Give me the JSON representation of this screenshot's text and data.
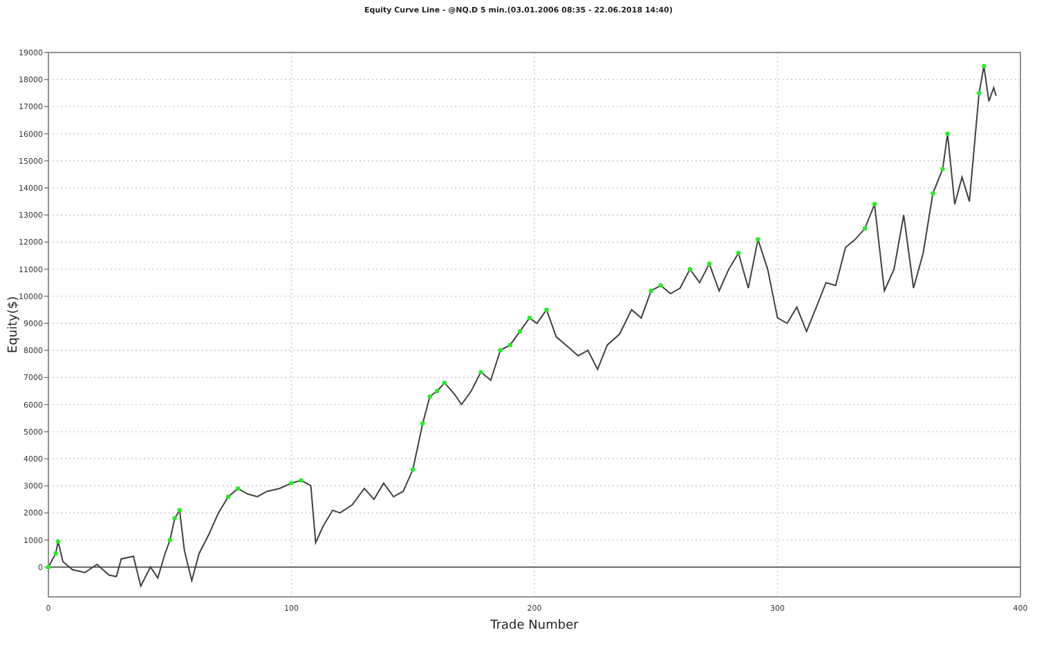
{
  "chart": {
    "chart_data": {
      "type": "line",
      "title": "Equity Curve Line - @NQ.D 5 min.(03.01.2006 08:35 - 22.06.2018 14:40)",
      "xlabel": "Trade Number",
      "ylabel": "Equity($)",
      "x": [
        0,
        3,
        4,
        6,
        10,
        15,
        20,
        25,
        28,
        30,
        35,
        38,
        42,
        45,
        48,
        50,
        52,
        54,
        56,
        59,
        62,
        66,
        70,
        74,
        78,
        82,
        86,
        90,
        95,
        100,
        104,
        108,
        110,
        113,
        117,
        120,
        125,
        130,
        134,
        138,
        142,
        146,
        150,
        154,
        157,
        160,
        163,
        167,
        170,
        174,
        178,
        182,
        186,
        190,
        194,
        198,
        201,
        205,
        209,
        213,
        218,
        222,
        226,
        230,
        235,
        240,
        244,
        248,
        252,
        256,
        260,
        264,
        268,
        272,
        276,
        280,
        284,
        288,
        292,
        296,
        300,
        304,
        308,
        312,
        316,
        320,
        324,
        328,
        332,
        336,
        340,
        344,
        348,
        352,
        356,
        360,
        364,
        368,
        370,
        373,
        376,
        379,
        381,
        383,
        385,
        387,
        389,
        390
      ],
      "series": [
        {
          "color": "#404040",
          "values": [
            0,
            500,
            950,
            200,
            -100,
            -200,
            100,
            -300,
            -350,
            300,
            400,
            -700,
            0,
            -400,
            500,
            1000,
            1800,
            2100,
            600,
            -500,
            500,
            1200,
            2000,
            2600,
            2900,
            2700,
            2600,
            2800,
            2900,
            3100,
            3200,
            3000,
            900,
            1500,
            2100,
            2000,
            2300,
            2900,
            2500,
            3100,
            2600,
            2800,
            3600,
            5300,
            6300,
            6500,
            6800,
            6400,
            6000,
            6500,
            7200,
            6900,
            8000,
            8200,
            8700,
            9200,
            9000,
            9500,
            8500,
            8200,
            7800,
            8000,
            7300,
            8200,
            8600,
            9500,
            9200,
            10200,
            10400,
            10100,
            10300,
            11000,
            10500,
            11200,
            10200,
            11000,
            11600,
            10300,
            12100,
            11000,
            9200,
            9000,
            9600,
            8700,
            9600,
            10500,
            10400,
            11800,
            12100,
            12500,
            13400,
            10200,
            11000,
            13000,
            10300,
            11600,
            13800,
            14700,
            16000,
            13400,
            14400,
            13500,
            15500,
            17500,
            18500,
            17200,
            17700,
            17400
          ]
        }
      ],
      "grid": true,
      "xlim": [
        0,
        400
      ],
      "ylim": [
        -1100,
        19000
      ],
      "xticks": [
        0,
        100,
        200,
        300,
        400
      ],
      "yticks": [
        0,
        1000,
        2000,
        3000,
        4000,
        5000,
        6000,
        7000,
        8000,
        9000,
        10000,
        11000,
        12000,
        13000,
        14000,
        15000,
        16000,
        17000,
        18000,
        19000
      ]
    }
  }
}
